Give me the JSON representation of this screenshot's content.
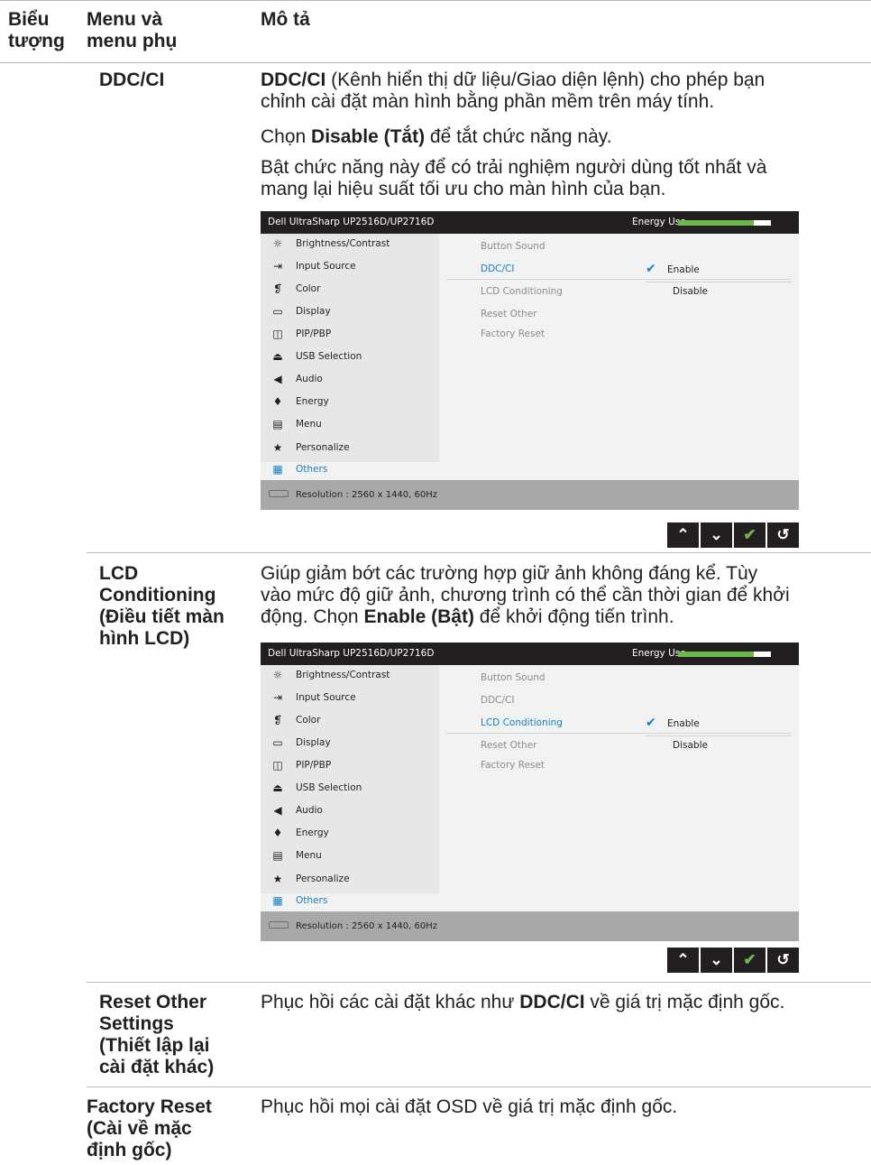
{
  "header": {
    "col1": "Biểu tượng",
    "col1_line1": "Biểu",
    "col1_line2": "tượng",
    "col2_line1": "Menu và",
    "col2_line2": "menu phụ",
    "col3": "Mô tả"
  },
  "rows": {
    "ddc": {
      "name": "DDC/CI",
      "desc1_bold": "DDC/CI",
      "desc1_line1_rest": " (Kênh hiển thị dữ liệu/Giao diện lệnh) cho phép bạn",
      "desc1_line2": "chỉnh cài đặt màn hình bằng phần mềm trên máy tính.",
      "desc2_pre": "Chọn ",
      "desc2_bold": "Disable (Tắt)",
      "desc2_post": " để tắt chức năng này.",
      "desc3_line1": "Bật chức năng này để có trải nghiệm người dùng tốt nhất và",
      "desc3_line2": "mang lại hiệu suất tối ưu cho màn hình của bạn."
    },
    "lcd": {
      "name_line1": "LCD",
      "name_line2": "Conditioning",
      "name_line3": "(Điều tiết màn",
      "name_line4": "hình LCD)",
      "desc_line1": "Giúp giảm bớt các trường hợp giữ ảnh không đáng kể. Tùy",
      "desc_line2": "vào mức độ giữ ảnh, chương trình có thể cần thời gian để khởi",
      "desc_line3_pre": "động. Chọn ",
      "desc_line3_bold": "Enable (Bật)",
      "desc_line3_post": " để khởi động tiến trình."
    },
    "reset_other": {
      "name_line1": "Reset Other",
      "name_line2": "Settings",
      "name_line3": "(Thiết lập lại",
      "name_line4": "cài đặt khác)",
      "desc_pre": "Phục hồi các cài đặt khác như ",
      "desc_bold": "DDC/CI",
      "desc_post": " về giá trị mặc định gốc."
    },
    "factory": {
      "name_line1": "Factory Reset",
      "name_line2": "(Cài về mặc",
      "name_line3": "định gốc)",
      "desc": "Phục hồi mọi cài đặt OSD về giá trị mặc định gốc."
    }
  },
  "osd": {
    "title": "Dell UltraSharp UP2516D/UP2716D",
    "energy_label": "Energy Use",
    "energy_level": 0.82,
    "menu": [
      {
        "label": "Brightness/Contrast",
        "icon": "brightness-icon",
        "glyph": "☼"
      },
      {
        "label": "Input Source",
        "icon": "input-source-icon",
        "glyph": "⇥"
      },
      {
        "label": "Color",
        "icon": "color-icon",
        "glyph": "❡"
      },
      {
        "label": "Display",
        "icon": "display-icon",
        "glyph": "▭"
      },
      {
        "label": "PIP/PBP",
        "icon": "pip-icon",
        "glyph": "◫"
      },
      {
        "label": "USB Selection",
        "icon": "usb-icon",
        "glyph": "⏏"
      },
      {
        "label": "Audio",
        "icon": "audio-icon",
        "glyph": "◀"
      },
      {
        "label": "Energy",
        "icon": "energy-icon",
        "glyph": "♦"
      },
      {
        "label": "Menu",
        "icon": "menu-icon",
        "glyph": "▤"
      },
      {
        "label": "Personalize",
        "icon": "star-icon",
        "glyph": "★"
      },
      {
        "label": "Others",
        "icon": "others-icon",
        "glyph": "▦"
      }
    ],
    "submenu": [
      "Button Sound",
      "DDC/CI",
      "LCD Conditioning",
      "Reset Other",
      "Factory Reset"
    ],
    "options": [
      "Enable",
      "Disable"
    ],
    "resolution": "Resolution : 2560 x 1440, 60Hz"
  },
  "nav_buttons": [
    "up-icon",
    "down-icon",
    "check-icon",
    "back-icon"
  ],
  "colors": {
    "accent": "#1a7cc1",
    "energy_bar": "#6cb84a",
    "osd_titlebar": "#231f20",
    "osd_footer": "#a8a9a6"
  }
}
